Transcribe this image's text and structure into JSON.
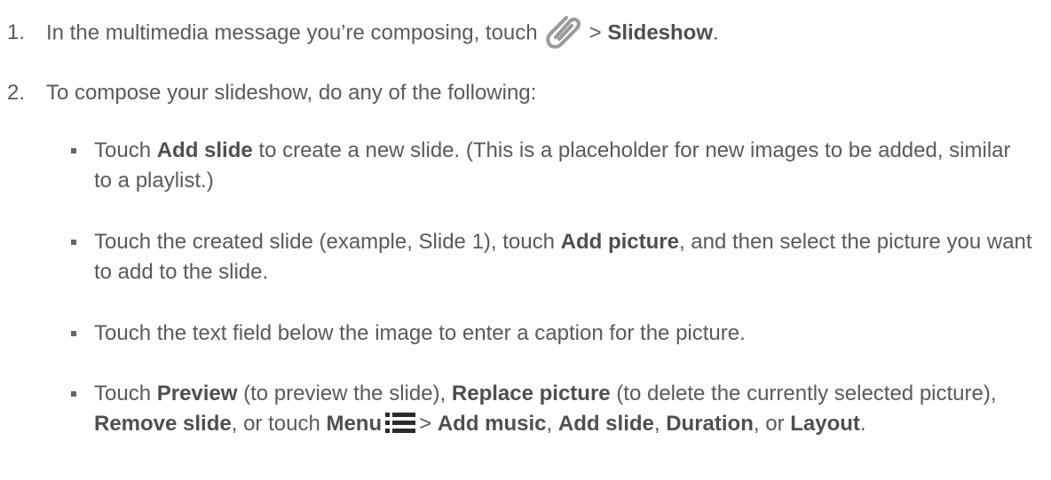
{
  "steps": [
    {
      "number": "1.",
      "prefix": "In the multimedia message you’re composing, touch",
      "sep": ">",
      "bold": "Slideshow",
      "end": "."
    },
    {
      "number": "2.",
      "text": "To compose your slideshow, do any of the following:"
    }
  ],
  "bullets": {
    "b1": {
      "pre": "Touch",
      "bold": "Add slide",
      "post": "to create a new slide. (This is a placeholder for new images to be added, similar to a playlist.)"
    },
    "b2": {
      "pre": "Touch the created slide (example, Slide 1), touch",
      "bold": "Add picture",
      "post": ", and then select the picture you want to add to the slide."
    },
    "b3": {
      "text": "Touch the text field below the image to enter a caption for the picture."
    },
    "b4": {
      "t1": "Touch",
      "b1": "Preview",
      "t2": "(to preview the slide),",
      "b2": "Replace picture",
      "t3": "(to delete the currently selected picture),",
      "b3": "Remove slide",
      "t4": ", or touch",
      "b4": "Menu",
      "sep": ">",
      "b5": "Add music",
      "t5": ",",
      "b6": "Add slide",
      "t6": ",",
      "b7": "Duration",
      "t7": ", or",
      "b8": "Layout",
      "t8": "."
    }
  },
  "icons": {
    "attach": "paperclip-icon",
    "menu": "menu-icon"
  },
  "colors": {
    "text": "#5a5a5a",
    "icon_gray": "#9a9a9a",
    "icon_dark": "#2b2b2b"
  }
}
